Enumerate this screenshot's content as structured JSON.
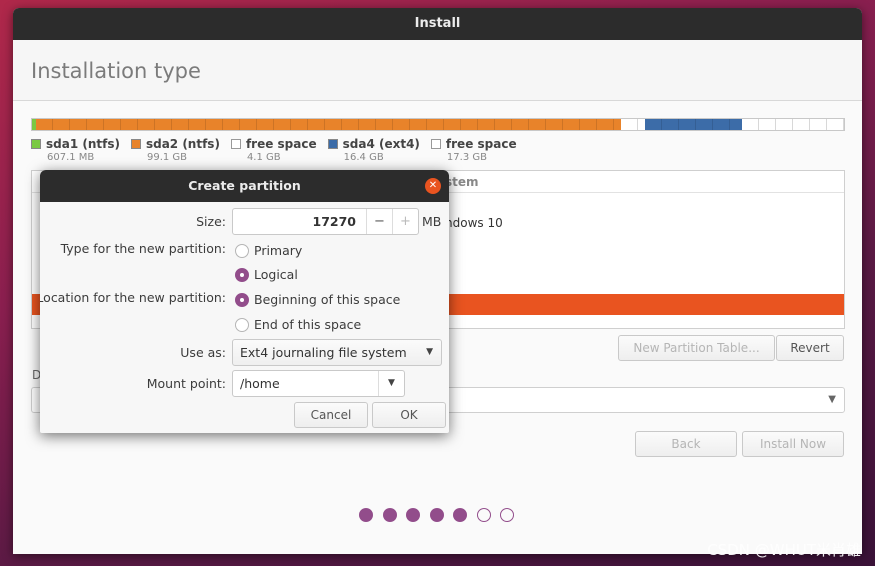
{
  "window": {
    "title": "Install",
    "heading": "Installation type"
  },
  "partitions": [
    {
      "name": "sda1 (ntfs)",
      "size": "607.1 MB",
      "color": "#7ac943",
      "fraction": 0.0045
    },
    {
      "name": "sda2 (ntfs)",
      "size": "99.1 GB",
      "color": "#e8832a",
      "fraction": 0.728
    },
    {
      "name": "free space",
      "size": "4.1 GB",
      "color": "#ffffff",
      "fraction": 0.0301
    },
    {
      "name": "sda4 (ext4)",
      "size": "16.4 GB",
      "color": "#3c6ca8",
      "fraction": 0.1205
    },
    {
      "name": "free space",
      "size": "17.3 GB",
      "color": "#ffffff",
      "fraction": 0.1271
    }
  ],
  "table": {
    "header_fragment": "stem",
    "system_fragment": "ndows 10"
  },
  "buttons": {
    "new_partition_table": "New Partition Table...",
    "revert": "Revert",
    "back": "Back",
    "install_now": "Install Now"
  },
  "fragments": {
    "d_label": "D"
  },
  "dialog": {
    "title": "Create partition",
    "size_label": "Size:",
    "size_value": "17270",
    "size_unit": "MB",
    "minus": "−",
    "plus": "+",
    "type_label": "Type for the new partition:",
    "type_options": [
      "Primary",
      "Logical"
    ],
    "type_selected": "Logical",
    "location_label": "Location for the new partition:",
    "location_options": [
      "Beginning of this space",
      "End of this space"
    ],
    "location_selected": "Beginning of this space",
    "use_as_label": "Use as:",
    "use_as_value": "Ext4 journaling file system",
    "mount_label": "Mount point:",
    "mount_value": "/home",
    "cancel": "Cancel",
    "ok": "OK"
  },
  "progress": {
    "total_steps": 7,
    "completed_steps": 5
  },
  "watermark": "CSDN @WHUT米肖雄",
  "colors": {
    "accent": "#e95420",
    "purple": "#924d8b",
    "titlebar": "#2c2c2c"
  }
}
